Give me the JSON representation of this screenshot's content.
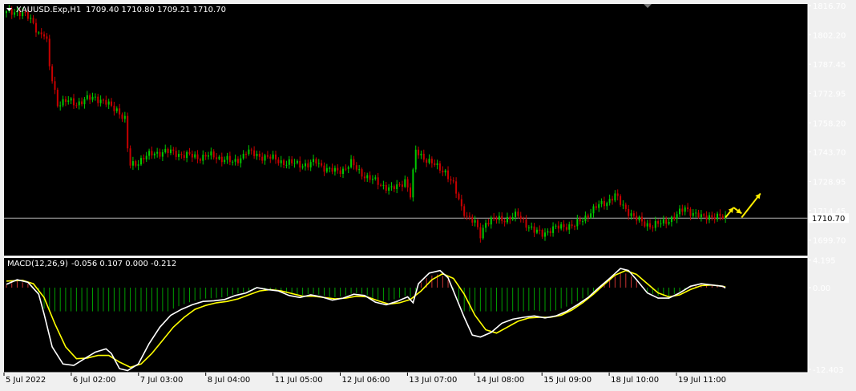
{
  "symbol_title": "XAUUSD.Exp,H1",
  "ohlc_readout": "1709.40 1710.80 1709.21 1710.70",
  "macd_title": "MACD(12,26,9)",
  "macd_readout": "-0.056 0.107 0.000 -0.212",
  "colors": {
    "background": "#000000",
    "frame": "#f0f0f0",
    "grid_line": "#ffffff",
    "bull_candle": "#00c800",
    "bear_candle": "#c80000",
    "macd_main": "#ffffff",
    "macd_signal": "#ffff00",
    "hist_positive": "#c83232",
    "hist_negative": "#00a000",
    "arrow": "#ffee00"
  },
  "chart_data": [
    {
      "type": "candlestick",
      "title": "XAUUSD.Exp,H1",
      "ylim": [
        1692.0,
        1817.5
      ],
      "y_ticks": [
        "1816.70",
        "1802.20",
        "1787.45",
        "1772.95",
        "1758.20",
        "1743.70",
        "1728.95",
        "1714.45",
        "1699.70"
      ],
      "current_price": "1710.70",
      "x_labels": [
        "5 Jul 2022",
        "6 Jul 02:00",
        "7 Jul 03:00",
        "8 Jul 04:00",
        "11 Jul 05:00",
        "12 Jul 06:00",
        "13 Jul 07:00",
        "14 Jul 08:00",
        "15 Jul 09:00",
        "18 Jul 10:00",
        "19 Jul 11:00"
      ],
      "price_path": [
        [
          0,
          1813
        ],
        [
          4,
          1814
        ],
        [
          7,
          1812
        ],
        [
          10,
          1808
        ],
        [
          12,
          1803
        ],
        [
          14,
          1802
        ],
        [
          15,
          1798
        ],
        [
          16,
          1786
        ],
        [
          19,
          1768
        ],
        [
          23,
          1769
        ],
        [
          26,
          1768
        ],
        [
          30,
          1770
        ],
        [
          33,
          1771
        ],
        [
          36,
          1769
        ],
        [
          39,
          1766
        ],
        [
          41,
          1765
        ],
        [
          44,
          1760
        ],
        [
          45,
          1745
        ],
        [
          46,
          1737
        ],
        [
          48,
          1738
        ],
        [
          51,
          1741
        ],
        [
          55,
          1743
        ],
        [
          59,
          1744
        ],
        [
          63,
          1743
        ],
        [
          67,
          1742
        ],
        [
          71,
          1741
        ],
        [
          75,
          1742
        ],
        [
          78,
          1741
        ],
        [
          82,
          1740
        ],
        [
          84,
          1738
        ],
        [
          87,
          1741
        ],
        [
          89,
          1744
        ],
        [
          93,
          1742
        ],
        [
          97,
          1741
        ],
        [
          100,
          1740
        ],
        [
          104,
          1738
        ],
        [
          108,
          1738
        ],
        [
          112,
          1737
        ],
        [
          115,
          1739
        ],
        [
          119,
          1735
        ],
        [
          122,
          1734
        ],
        [
          125,
          1735
        ],
        [
          128,
          1738
        ],
        [
          131,
          1734
        ],
        [
          134,
          1731
        ],
        [
          137,
          1729
        ],
        [
          140,
          1727
        ],
        [
          143,
          1725
        ],
        [
          146,
          1727
        ],
        [
          148,
          1730
        ],
        [
          150,
          1722
        ],
        [
          152,
          1744
        ],
        [
          154,
          1742
        ],
        [
          157,
          1739
        ],
        [
          160,
          1736
        ],
        [
          163,
          1734
        ],
        [
          166,
          1727
        ],
        [
          169,
          1716
        ],
        [
          171,
          1712
        ],
        [
          174,
          1708
        ],
        [
          176,
          1702
        ],
        [
          178,
          1709
        ],
        [
          181,
          1710
        ],
        [
          184,
          1710
        ],
        [
          187,
          1711
        ],
        [
          190,
          1712
        ],
        [
          193,
          1708
        ],
        [
          196,
          1704
        ],
        [
          199,
          1703
        ],
        [
          202,
          1705
        ],
        [
          205,
          1706
        ],
        [
          208,
          1707
        ],
        [
          211,
          1707
        ],
        [
          214,
          1710
        ],
        [
          217,
          1714
        ],
        [
          220,
          1717
        ],
        [
          223,
          1719
        ],
        [
          226,
          1722
        ],
        [
          228,
          1718
        ],
        [
          231,
          1714
        ],
        [
          234,
          1710
        ],
        [
          237,
          1708
        ],
        [
          240,
          1707
        ],
        [
          243,
          1708
        ],
        [
          246,
          1710
        ],
        [
          249,
          1712
        ],
        [
          252,
          1716
        ],
        [
          255,
          1713
        ],
        [
          258,
          1711
        ],
        [
          261,
          1712
        ],
        [
          264,
          1711
        ],
        [
          267,
          1711
        ]
      ],
      "forecast_arrows": [
        {
          "x1": 267,
          "y1": 1711,
          "x2": 270,
          "y2": 1716
        },
        {
          "x1": 270,
          "y1": 1716,
          "x2": 273,
          "y2": 1713
        },
        {
          "x1": 273,
          "y1": 1711,
          "x2": 280,
          "y2": 1723
        }
      ]
    },
    {
      "type": "macd",
      "title": "MACD(12,26,9)",
      "ylim": [
        -12.9,
        4.5
      ],
      "y_ticks": [
        {
          "value": 4.195,
          "label": "4.195"
        },
        {
          "value": 0.0,
          "label": "0.00"
        },
        {
          "value": -12.403,
          "label": "-12.403"
        }
      ],
      "main_line": [
        [
          0,
          0.5
        ],
        [
          4,
          1.2
        ],
        [
          8,
          0.8
        ],
        [
          12,
          -1
        ],
        [
          14,
          -4
        ],
        [
          17,
          -9
        ],
        [
          21,
          -11.6
        ],
        [
          25,
          -11.8
        ],
        [
          29,
          -10.8
        ],
        [
          33,
          -9.8
        ],
        [
          37,
          -9.3
        ],
        [
          39,
          -10
        ],
        [
          42,
          -12.3
        ],
        [
          45,
          -12.6
        ],
        [
          49,
          -11.6
        ],
        [
          53,
          -8.5
        ],
        [
          57,
          -6
        ],
        [
          61,
          -4.2
        ],
        [
          65,
          -3.3
        ],
        [
          69,
          -2.6
        ],
        [
          73,
          -2.1
        ],
        [
          77,
          -2.0
        ],
        [
          81,
          -1.8
        ],
        [
          85,
          -1.2
        ],
        [
          89,
          -0.8
        ],
        [
          93,
          0
        ],
        [
          97,
          -0.3
        ],
        [
          101,
          -0.5
        ],
        [
          105,
          -1.2
        ],
        [
          109,
          -1.5
        ],
        [
          113,
          -1.1
        ],
        [
          117,
          -1.4
        ],
        [
          121,
          -1.9
        ],
        [
          125,
          -1.6
        ],
        [
          129,
          -1.0
        ],
        [
          133,
          -1.2
        ],
        [
          137,
          -2.2
        ],
        [
          141,
          -2.6
        ],
        [
          145,
          -2.1
        ],
        [
          149,
          -1.4
        ],
        [
          151,
          -2.3
        ],
        [
          153,
          0.6
        ],
        [
          157,
          2.2
        ],
        [
          161,
          2.6
        ],
        [
          164,
          1.5
        ],
        [
          167,
          -1.5
        ],
        [
          170,
          -4.5
        ],
        [
          173,
          -7.2
        ],
        [
          176,
          -7.5
        ],
        [
          180,
          -6.8
        ],
        [
          184,
          -5.4
        ],
        [
          188,
          -4.8
        ],
        [
          192,
          -4.5
        ],
        [
          196,
          -4.3
        ],
        [
          200,
          -4.6
        ],
        [
          204,
          -4.3
        ],
        [
          208,
          -3.6
        ],
        [
          212,
          -2.6
        ],
        [
          216,
          -1.5
        ],
        [
          220,
          0
        ],
        [
          224,
          1.4
        ],
        [
          228,
          2.9
        ],
        [
          231,
          2.6
        ],
        [
          234,
          1.2
        ],
        [
          238,
          -0.8
        ],
        [
          242,
          -1.6
        ],
        [
          246,
          -1.6
        ],
        [
          250,
          -0.8
        ],
        [
          254,
          0.2
        ],
        [
          258,
          0.6
        ],
        [
          262,
          0.4
        ],
        [
          266,
          0.2
        ],
        [
          267,
          -0.056
        ]
      ],
      "signal_line": [
        [
          0,
          1.0
        ],
        [
          6,
          1.1
        ],
        [
          10,
          0.6
        ],
        [
          14,
          -1.5
        ],
        [
          18,
          -5.5
        ],
        [
          22,
          -9.0
        ],
        [
          26,
          -10.8
        ],
        [
          30,
          -10.7
        ],
        [
          34,
          -10.3
        ],
        [
          38,
          -10.3
        ],
        [
          42,
          -11.3
        ],
        [
          46,
          -12.1
        ],
        [
          50,
          -11.6
        ],
        [
          54,
          -10.0
        ],
        [
          58,
          -8.0
        ],
        [
          62,
          -6.0
        ],
        [
          66,
          -4.5
        ],
        [
          70,
          -3.3
        ],
        [
          74,
          -2.7
        ],
        [
          78,
          -2.3
        ],
        [
          82,
          -2.1
        ],
        [
          86,
          -1.7
        ],
        [
          90,
          -1.1
        ],
        [
          94,
          -0.5
        ],
        [
          98,
          -0.3
        ],
        [
          102,
          -0.5
        ],
        [
          106,
          -0.9
        ],
        [
          110,
          -1.3
        ],
        [
          114,
          -1.3
        ],
        [
          118,
          -1.5
        ],
        [
          122,
          -1.7
        ],
        [
          126,
          -1.6
        ],
        [
          130,
          -1.3
        ],
        [
          134,
          -1.4
        ],
        [
          138,
          -2.0
        ],
        [
          142,
          -2.5
        ],
        [
          146,
          -2.3
        ],
        [
          150,
          -1.8
        ],
        [
          154,
          -0.5
        ],
        [
          158,
          1.2
        ],
        [
          162,
          2.1
        ],
        [
          166,
          1.4
        ],
        [
          170,
          -1.0
        ],
        [
          174,
          -4.2
        ],
        [
          178,
          -6.4
        ],
        [
          182,
          -6.9
        ],
        [
          186,
          -6.0
        ],
        [
          190,
          -5.1
        ],
        [
          194,
          -4.6
        ],
        [
          198,
          -4.5
        ],
        [
          202,
          -4.5
        ],
        [
          206,
          -4.2
        ],
        [
          210,
          -3.4
        ],
        [
          214,
          -2.3
        ],
        [
          218,
          -1.0
        ],
        [
          222,
          0.5
        ],
        [
          226,
          1.9
        ],
        [
          230,
          2.6
        ],
        [
          234,
          2.0
        ],
        [
          238,
          0.6
        ],
        [
          242,
          -0.8
        ],
        [
          246,
          -1.4
        ],
        [
          250,
          -1.1
        ],
        [
          254,
          -0.3
        ],
        [
          258,
          0.3
        ],
        [
          262,
          0.4
        ],
        [
          266,
          0.2
        ],
        [
          267,
          0.107
        ]
      ]
    }
  ]
}
